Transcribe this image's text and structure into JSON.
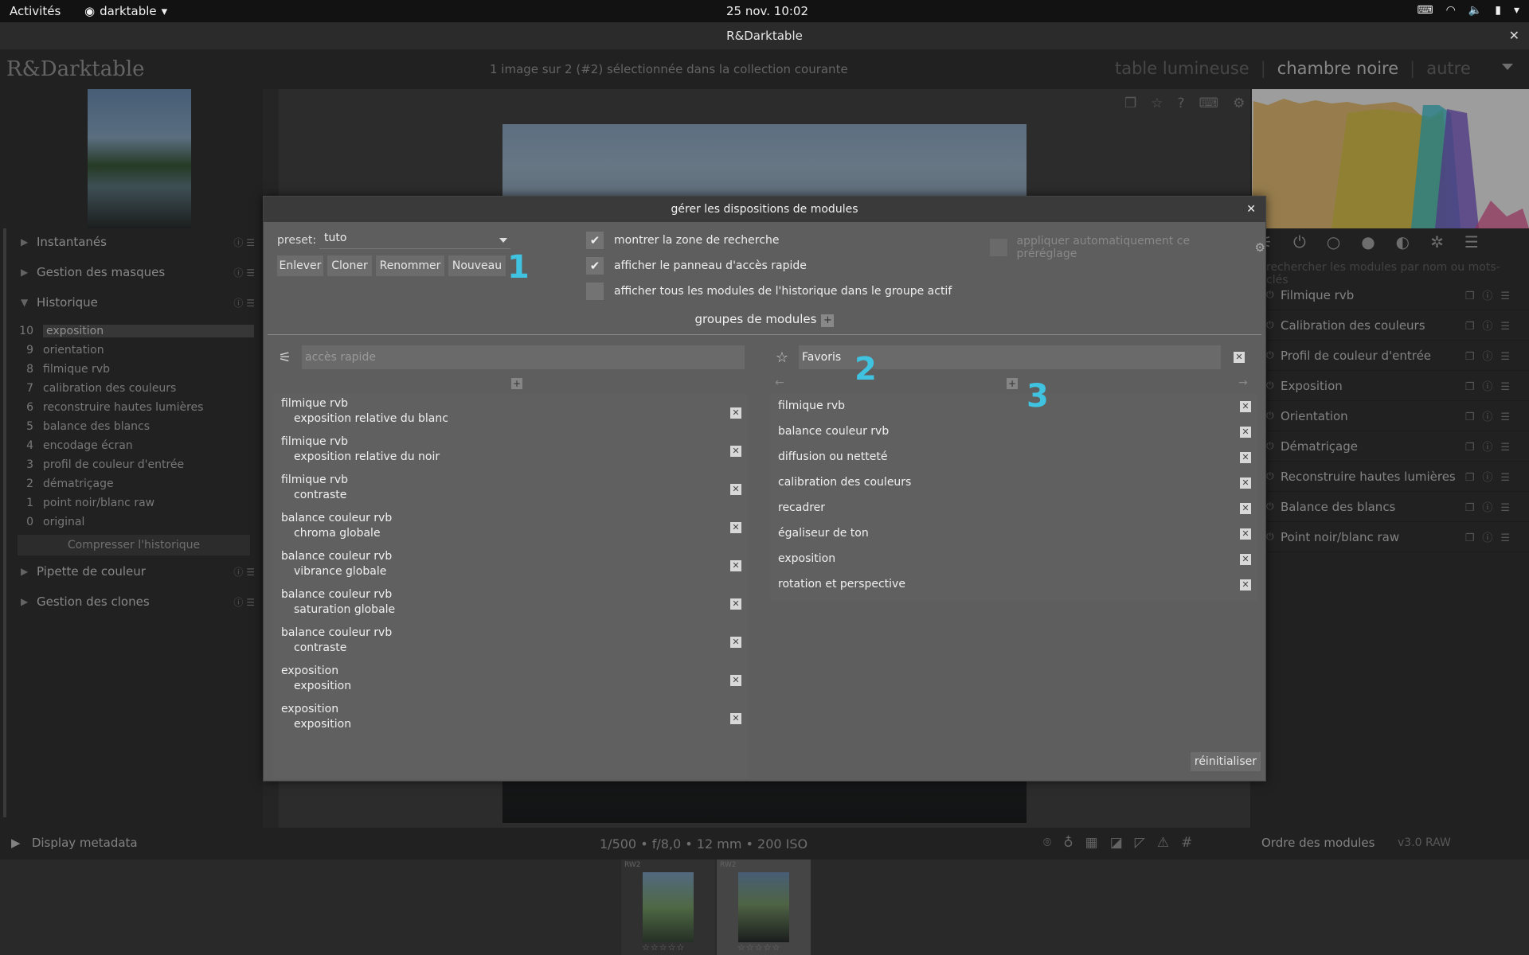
{
  "topbar": {
    "activities": "Activités",
    "app_name": "darktable",
    "clock": "25 nov.  10:02",
    "tray_icons": [
      "keyboard-layout-icon",
      "wifi-icon",
      "volume-icon",
      "battery-icon",
      "system-menu-icon"
    ]
  },
  "window": {
    "title": "R&Darktable"
  },
  "header": {
    "logo": "R&Darktable",
    "collection_info": "1 image sur 2 (#2) sélectionnée dans la collection courante",
    "views": [
      "table lumineuse",
      "chambre noire",
      "autre"
    ],
    "active_view": "chambre noire"
  },
  "left": {
    "sections_top": [
      {
        "label": "Instantanés"
      },
      {
        "label": "Gestion des masques"
      },
      {
        "label": "Historique"
      }
    ],
    "history": [
      {
        "num": "10",
        "name": "exposition"
      },
      {
        "num": "9",
        "name": "orientation"
      },
      {
        "num": "8",
        "name": "filmique rvb"
      },
      {
        "num": "7",
        "name": "calibration des couleurs"
      },
      {
        "num": "6",
        "name": "reconstruire hautes lumières"
      },
      {
        "num": "5",
        "name": "balance des blancs"
      },
      {
        "num": "4",
        "name": "encodage écran"
      },
      {
        "num": "3",
        "name": "profil de couleur d'entrée"
      },
      {
        "num": "2",
        "name": "dématriçage"
      },
      {
        "num": "1",
        "name": "point noir/blanc raw"
      },
      {
        "num": "0",
        "name": "original"
      }
    ],
    "compress_label": "Compresser l'historique",
    "sections_bottom": [
      {
        "label": "Pipette de couleur"
      },
      {
        "label": "Gestion des clones"
      }
    ],
    "display_metadata": "Display metadata"
  },
  "right": {
    "search_placeholder": "rechercher les modules par nom ou mots-clés",
    "modules": [
      "Filmique rvb",
      "Calibration des couleurs",
      "Profil de couleur d'entrée",
      "Exposition",
      "Orientation",
      "Dématriçage",
      "Reconstruire hautes lumières",
      "Balance des blancs",
      "Point noir/blanc raw"
    ],
    "module_order_label": "Ordre des modules",
    "module_order_value": "v3.0 RAW"
  },
  "bottom": {
    "exif": "1/500 • f/8,0 • 12 mm • 200 ISO",
    "film_format": "RW2"
  },
  "dialog": {
    "title": "gérer les dispositions de modules",
    "preset_label": "preset:",
    "preset_value": "tuto",
    "buttons": {
      "remove": "Enlever",
      "clone": "Cloner",
      "rename": "Renommer",
      "new": "Nouveau"
    },
    "checks": [
      {
        "label": "montrer la zone de recherche",
        "checked": true
      },
      {
        "label": "afficher le panneau d'accès rapide",
        "checked": true
      },
      {
        "label": "afficher tous les modules de l'historique dans le groupe actif",
        "checked": false
      }
    ],
    "auto_apply": "appliquer automatiquement ce préréglage",
    "groups_title": "groupes de modules",
    "quick_access": {
      "placeholder": "accès rapide",
      "items": [
        {
          "module": "filmique rvb",
          "param": "exposition relative du blanc"
        },
        {
          "module": "filmique rvb",
          "param": "exposition relative du noir"
        },
        {
          "module": "filmique rvb",
          "param": "contraste"
        },
        {
          "module": "balance couleur rvb",
          "param": "chroma globale"
        },
        {
          "module": "balance couleur rvb",
          "param": "vibrance globale"
        },
        {
          "module": "balance couleur rvb",
          "param": "saturation globale"
        },
        {
          "module": "balance couleur rvb",
          "param": "contraste"
        },
        {
          "module": "exposition",
          "param": "exposition"
        },
        {
          "module": "exposition",
          "param": "exposition"
        }
      ]
    },
    "favorites": {
      "name": "Favoris",
      "items": [
        "filmique rvb",
        "balance couleur rvb",
        "diffusion ou netteté",
        "calibration des couleurs",
        "recadrer",
        "égaliseur de ton",
        "exposition",
        "rotation et perspective"
      ]
    },
    "reset_label": "réinitialiser",
    "annotations": [
      "1",
      "2",
      "3"
    ]
  }
}
